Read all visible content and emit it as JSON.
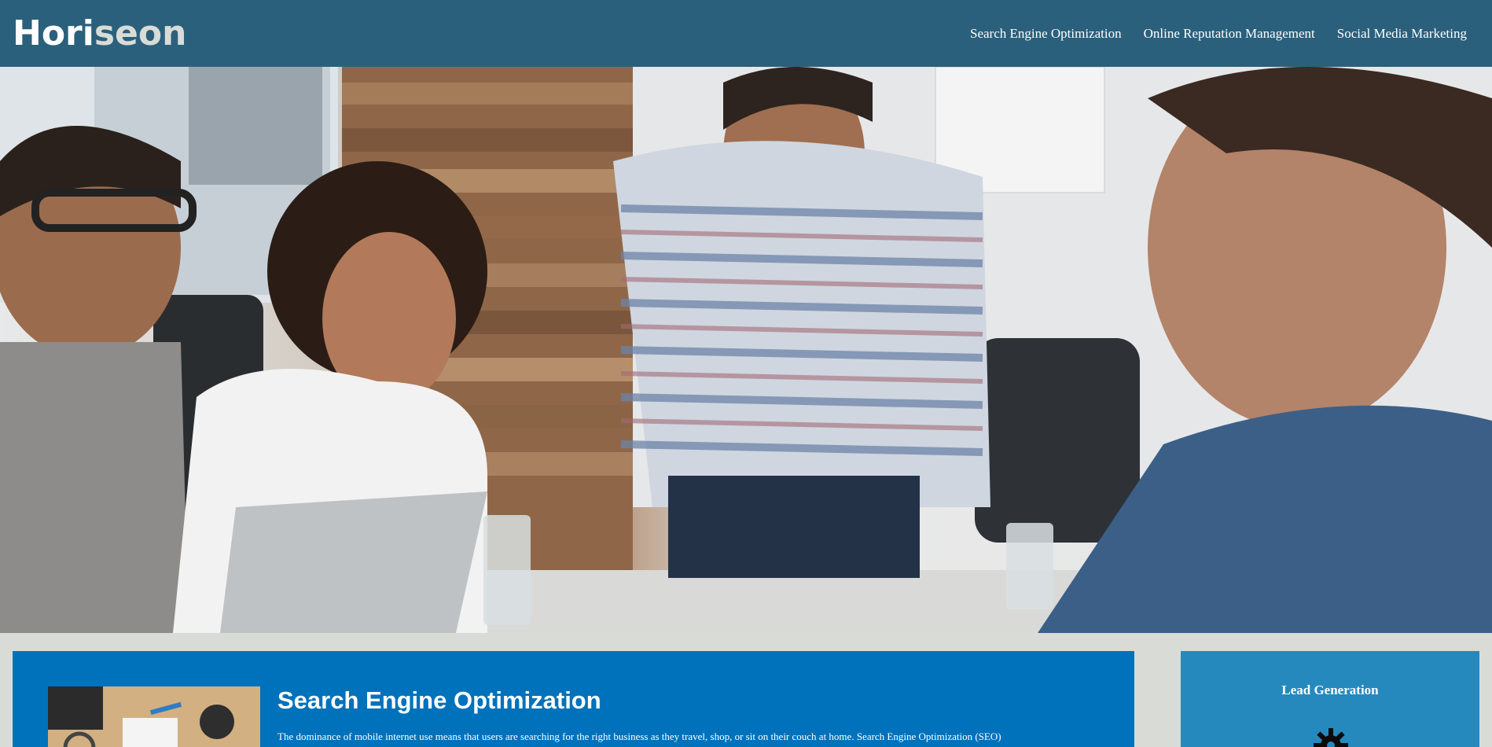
{
  "header": {
    "logo_main": "Hori",
    "logo_accent": "seon",
    "nav": [
      {
        "label": "Search Engine Optimization"
      },
      {
        "label": "Online Reputation Management"
      },
      {
        "label": "Social Media Marketing"
      }
    ]
  },
  "hero": {
    "image_alt": "team meeting photo"
  },
  "content": {
    "title": "Search Engine Optimization",
    "text": "The dominance of mobile internet use means that users are searching for the right business as they travel, shop, or sit on their couch at home. Search Engine Optimization (SEO)"
  },
  "aside": {
    "title": "Lead Generation",
    "icon": "gear-icon"
  },
  "colors": {
    "header_bg": "#2a607c",
    "page_bg": "#d9dcd6",
    "content_bg": "#0072bb",
    "aside_bg": "#2589bd"
  }
}
